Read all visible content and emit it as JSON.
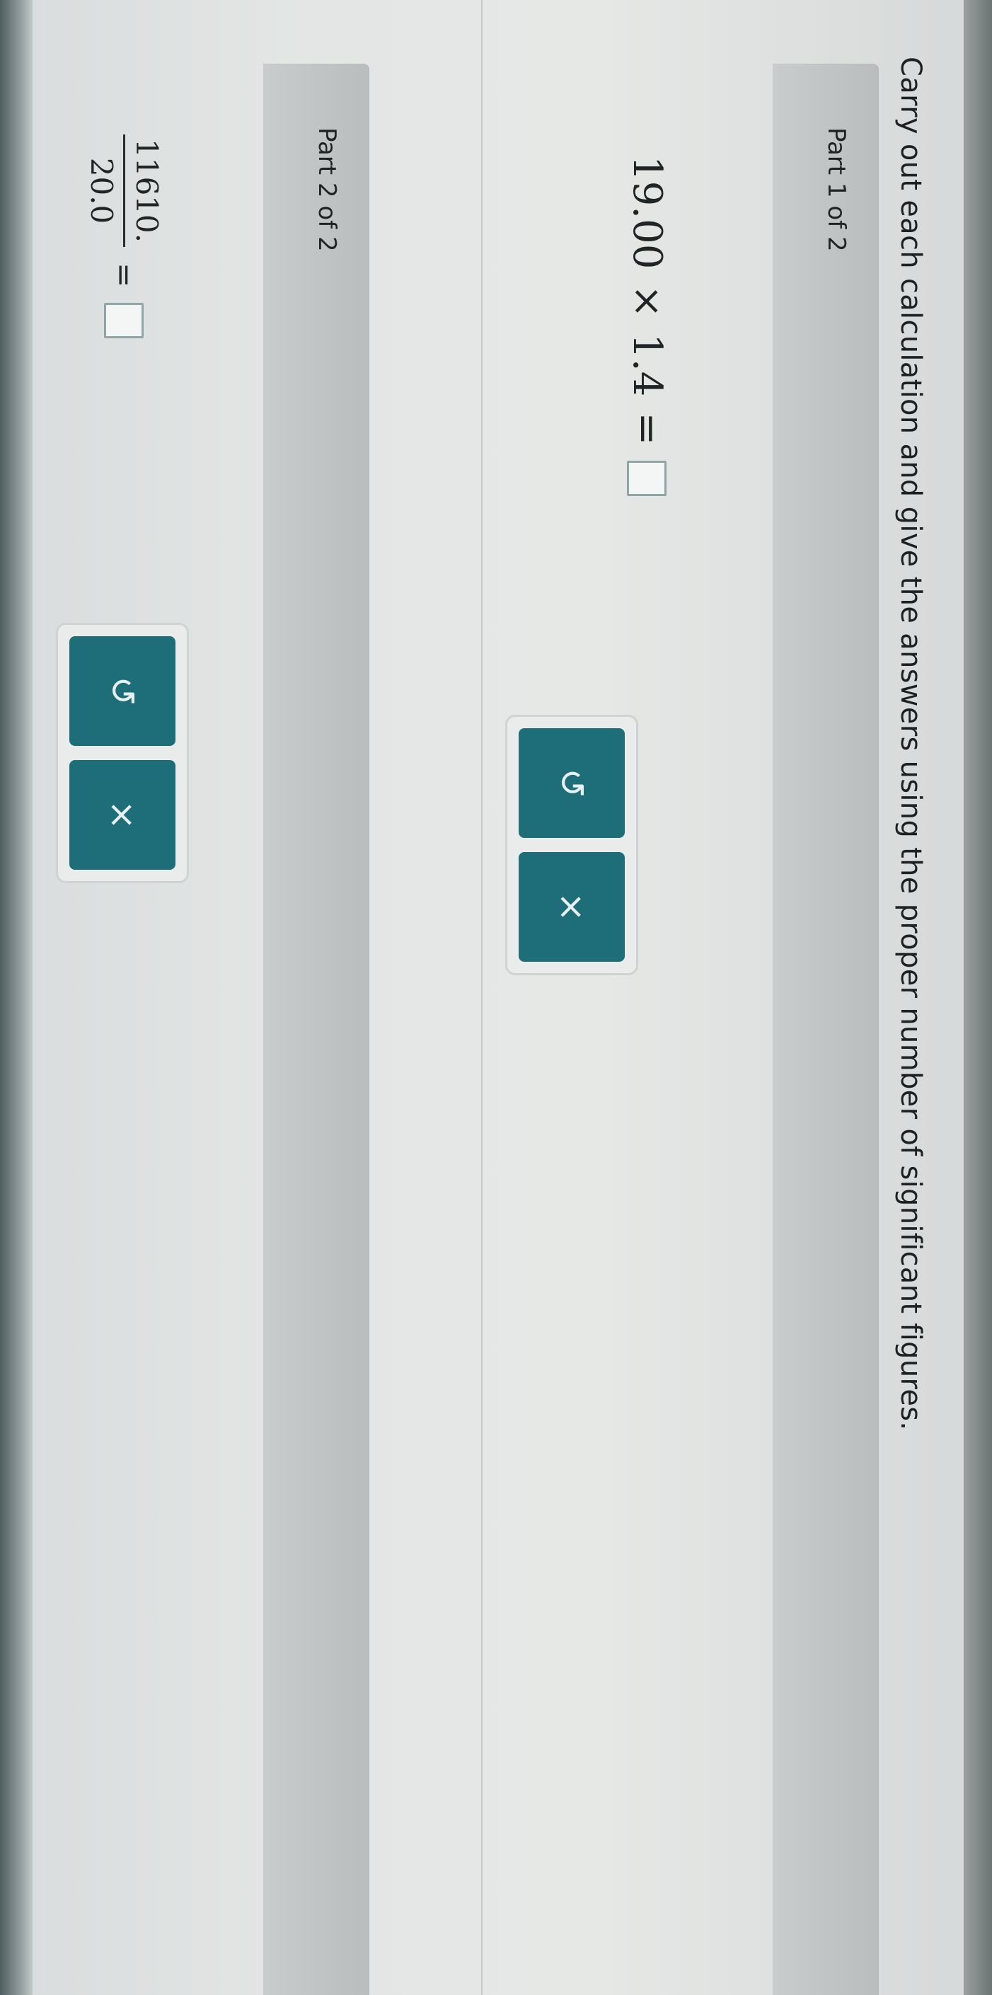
{
  "instructions": "Carry out each calculation and give the answers using the proper number of significant figures.",
  "parts": [
    {
      "label": "Part 1 of 2",
      "expression": {
        "operand_a": "19.00",
        "operator": "×",
        "operand_b": "1.4",
        "equals": "="
      },
      "answer_value": "",
      "buttons": {
        "undo_icon": "↺",
        "clear_icon": "×"
      }
    },
    {
      "label": "Part 2 of 2",
      "expression": {
        "numerator": "11610.",
        "denominator": "20.0",
        "equals": "="
      },
      "answer_value": "",
      "buttons": {
        "undo_icon": "↺",
        "clear_icon": "×"
      }
    }
  ],
  "colors": {
    "button_bg": "#1d6e78",
    "band_bg": "#bdc1c2"
  }
}
